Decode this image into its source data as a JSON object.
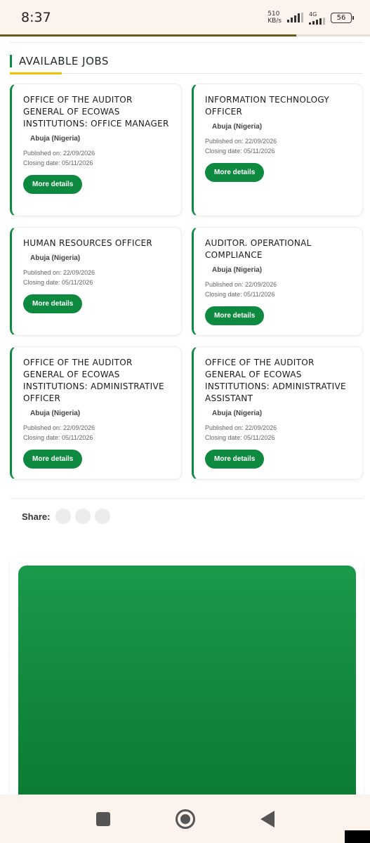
{
  "status_bar": {
    "time": "8:37",
    "net_speed_value": "510",
    "net_speed_unit": "KB/s",
    "network_type": "4G",
    "battery": "56"
  },
  "reading_progress": 0.8,
  "section": {
    "title": "AVAILABLE JOBS"
  },
  "jobs": [
    {
      "title": "OFFICE OF THE AUDITOR GENERAL OF ECOWAS INSTITUTIONS: OFFICE MANAGER",
      "location": "Abuja (Nigeria)",
      "published": "Published on: 22/09/2026",
      "closing": "Closing date: 05/11/2026",
      "button": "More details"
    },
    {
      "title": "INFORMATION TECHNOLOGY OFFICER",
      "location": "Abuja (Nigeria)",
      "published": "Published on: 22/09/2026",
      "closing": "Closing date: 05/11/2026",
      "button": "More details"
    },
    {
      "title": "HUMAN RESOURCES OFFICER",
      "location": "Abuja (Nigeria)",
      "published": "Published on: 22/09/2026",
      "closing": "Closing date: 05/11/2026",
      "button": "More details"
    },
    {
      "title": "AUDITOR. OPERATIONAL COMPLIANCE",
      "location": "Abuja (Nigeria)",
      "published": "Published on: 22/09/2026",
      "closing": "Closing date: 05/11/2026",
      "button": "More details"
    },
    {
      "title": "OFFICE OF THE AUDITOR GENERAL OF ECOWAS INSTITUTIONS: ADMINISTRATIVE OFFICER",
      "location": "Abuja (Nigeria)",
      "published": "Published on: 22/09/2026",
      "closing": "Closing date: 05/11/2026",
      "button": "More details"
    },
    {
      "title": "OFFICE OF THE AUDITOR GENERAL OF ECOWAS INSTITUTIONS: ADMINISTRATIVE ASSISTANT",
      "location": "Abuja (Nigeria)",
      "published": "Published on: 22/09/2026",
      "closing": "Closing date: 05/11/2026",
      "button": "More details"
    }
  ],
  "share": {
    "label": "Share:"
  },
  "colors": {
    "accent_green": "#0d8a3f",
    "accent_yellow": "#f2c200",
    "banner_green": "#12893e"
  },
  "nav": {
    "recent_icon": "square-icon",
    "home_icon": "circle-icon",
    "back_icon": "triangle-back-icon"
  }
}
